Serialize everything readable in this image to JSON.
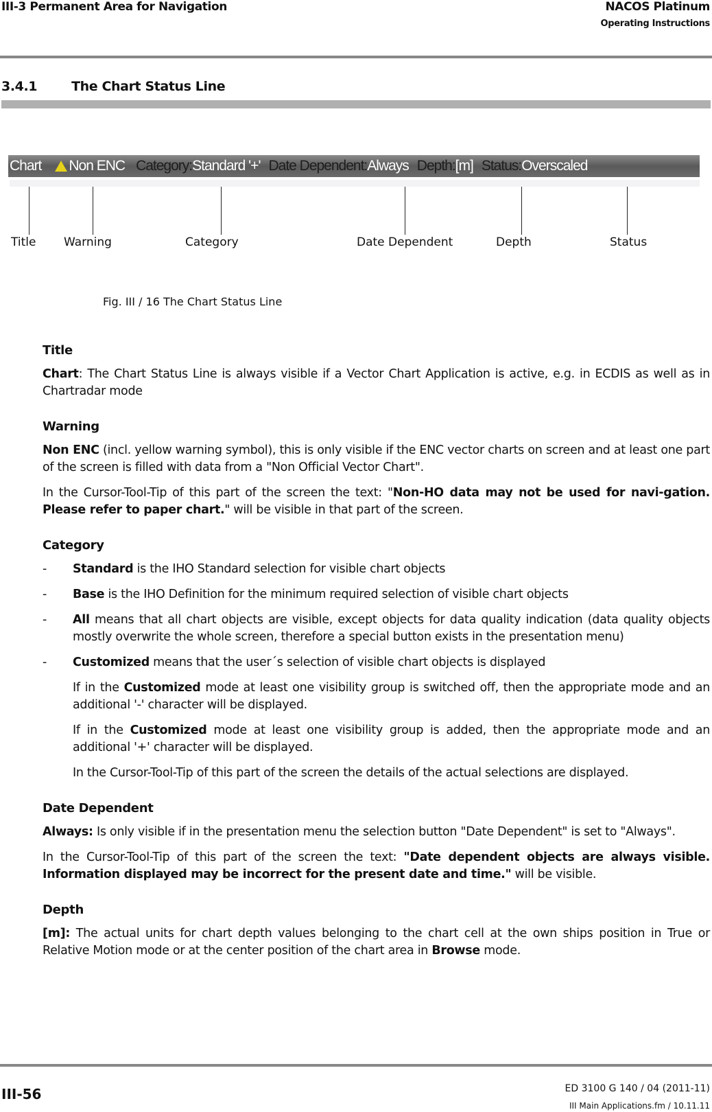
{
  "header": {
    "section": "III-3  Permanent Area for Navigation",
    "product": "NACOS Platinum",
    "doc_type": "Operating Instructions"
  },
  "heading": {
    "number": "3.4.1",
    "title": "The Chart Status Line"
  },
  "figure": {
    "status_line": {
      "title": "Chart",
      "warning": "Non ENC",
      "category_label": "Category:",
      "category_value": "Standard '+'",
      "date_label": "Date Dependent:",
      "date_value": "Always",
      "depth_label": "Depth:",
      "depth_value": "[m]",
      "status_label": "Status:",
      "status_value": "Overscaled",
      "warning_icon": "warning-triangle-icon",
      "warning_color": "#e6d21a"
    },
    "labels": [
      "Title",
      "Warning",
      "Category",
      "Date Dependent",
      "Depth",
      "Status"
    ],
    "caption": "Fig. III /  16 The Chart Status Line"
  },
  "sections": {
    "title": {
      "heading": "Title",
      "term": "Chart",
      "text": ": The Chart Status Line is always visible if a Vector Chart Application is active, e.g. in ECDIS as well as in Chartradar mode"
    },
    "warning": {
      "heading": "Warning",
      "term": "Non ENC",
      "text": " (incl. yellow warning symbol), this is only visible if the ENC vector charts on screen and at least one part of the screen is filled with data from a \"Non Official Vector Chart\".",
      "p2_a": "In the Cursor-Tool-Tip of this part of the screen the text: \"",
      "p2_bold": "Non-HO data may not be used for navi-gation. Please refer to paper chart.",
      "p2_b": "\" will be visible in that part of the screen."
    },
    "category": {
      "heading": "Category",
      "items": [
        {
          "dash": "-",
          "term": "Standard",
          "text": " is the IHO Standard selection for visible chart objects"
        },
        {
          "dash": "-",
          "term": "Base",
          "text": " is the IHO Definition for the minimum required selection of visible chart objects"
        },
        {
          "dash": "-",
          "term": "All",
          "text": " means that all chart objects are visible, except objects for data quality indication (data quality objects mostly overwrite the whole screen, therefore a special button exists in the presentation menu)"
        },
        {
          "dash": "-",
          "term": "Customized",
          "text": " means that the user´s selection of visible chart objects is displayed"
        }
      ],
      "p1_a": "If in the ",
      "p1_bold": "Customized",
      "p1_b": " mode at least one visibility group is switched off, then the appropriate mode and an additional '-' character will be displayed.",
      "p2_a": "If in the ",
      "p2_bold": "Customized",
      "p2_b": " mode at least one visibility group is added, then the appropriate mode and an additional '+' character will be displayed.",
      "p3": "In the Cursor-Tool-Tip of this part of the screen the details of the actual selections are displayed."
    },
    "date": {
      "heading": "Date Dependent",
      "term": "Always:",
      "text": " Is only visible if in the presentation menu the selection button \"Date Dependent\" is set to \"Always\".",
      "p2_a": "In the Cursor-Tool-Tip of this part of the screen the text: ",
      "p2_bold": "\"Date dependent objects are always visible. Information displayed may be incorrect for the present date and time.\"",
      "p2_b": " will be visible."
    },
    "depth": {
      "heading": "Depth",
      "term": "[m]:",
      "text": " The actual units for chart depth values belonging to the chart cell at the own ships position in True or Relative Motion mode or at the center position of the chart area in ",
      "bold2": "Browse",
      "text2": " mode."
    }
  },
  "footer": {
    "page": "III-56",
    "doc_id": "ED 3100 G 140 / 04 (2011-11)",
    "file": "III Main Applications.fm / 10.11.11"
  }
}
